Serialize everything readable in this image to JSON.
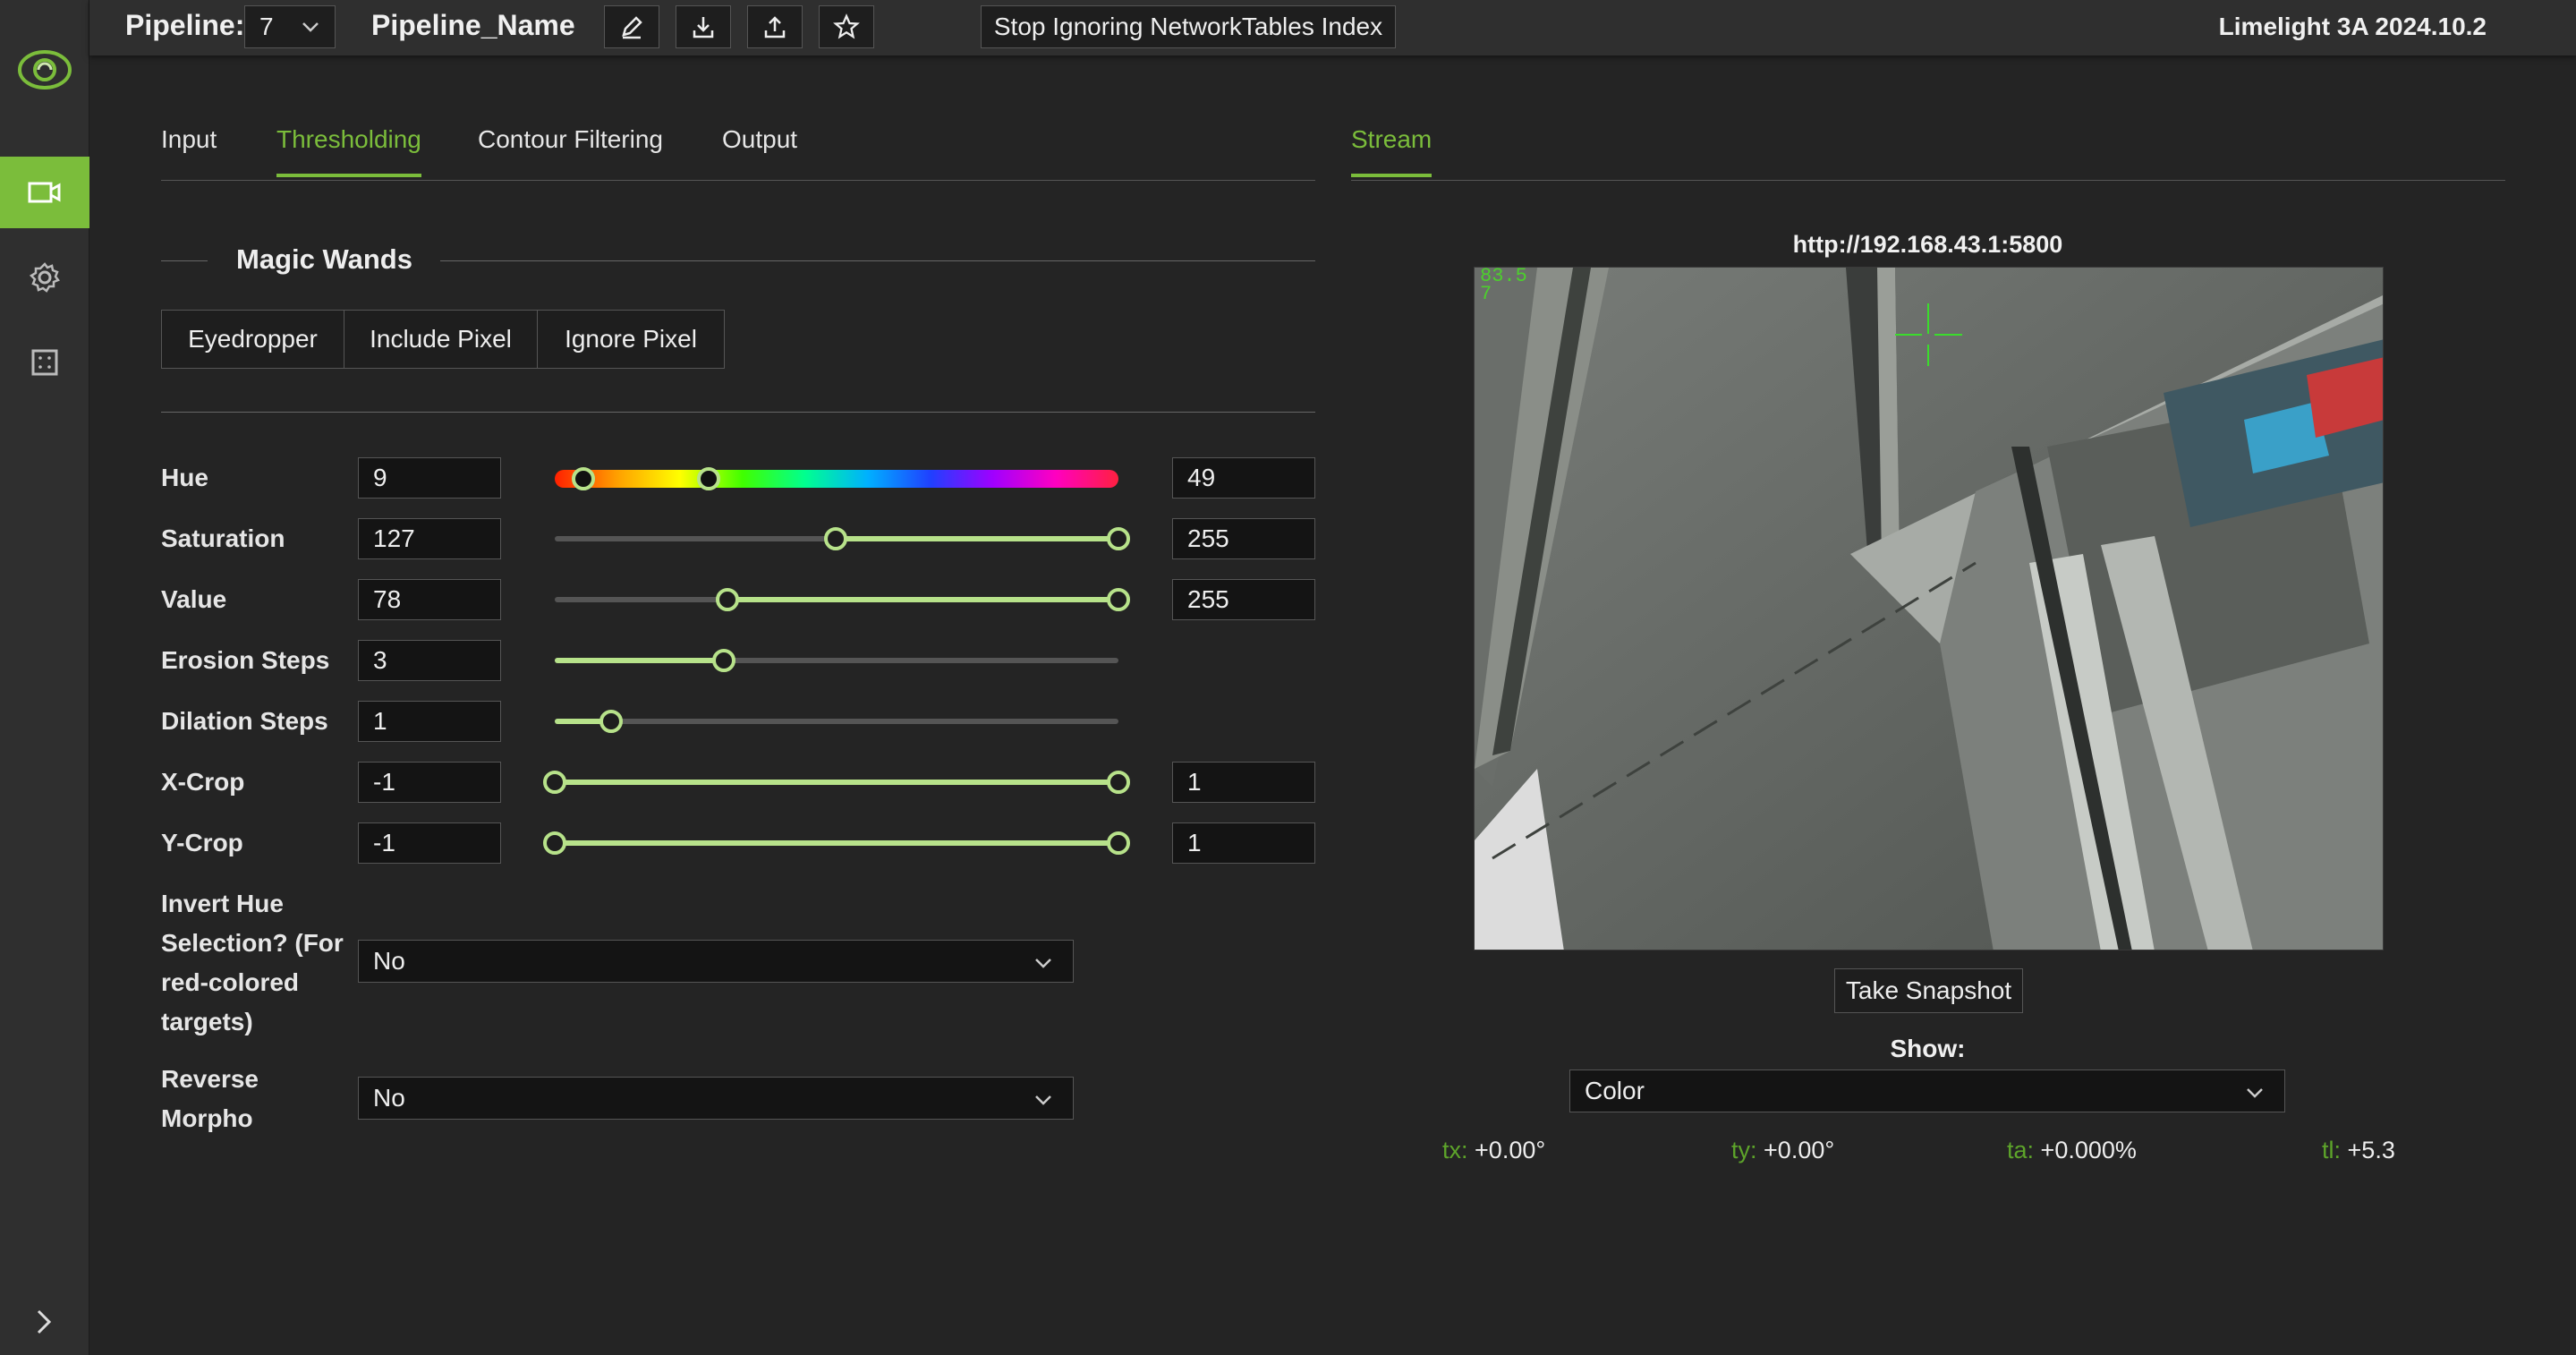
{
  "app": {
    "pipeline_label": "Pipeline:",
    "pipeline_number": "7",
    "pipeline_name": "Pipeline_Name",
    "stop_button": "Stop Ignoring NetworkTables Index",
    "version": "Limelight 3A 2024.10.2",
    "icons": [
      "logo-icon",
      "camera-icon",
      "gear-icon",
      "grid-icon",
      "edit-icon",
      "download-icon",
      "upload-icon",
      "star-icon",
      "chevron-right-icon"
    ]
  },
  "tabs": [
    {
      "label": "Input",
      "active": false
    },
    {
      "label": "Thresholding",
      "active": true
    },
    {
      "label": "Contour Filtering",
      "active": false
    },
    {
      "label": "Output",
      "active": false
    }
  ],
  "stream_tab": {
    "label": "Stream",
    "active": true
  },
  "magic_wands": {
    "title": "Magic Wands",
    "buttons": [
      "Eyedropper",
      "Include Pixel",
      "Ignore Pixel"
    ]
  },
  "thresholds": {
    "hue": {
      "label": "Hue",
      "min": "9",
      "max": "49",
      "range": 180
    },
    "saturation": {
      "label": "Saturation",
      "min": "127",
      "max": "255",
      "range": 255
    },
    "value": {
      "label": "Value",
      "min": "78",
      "max": "255",
      "range": 255
    },
    "erosion": {
      "label": "Erosion Steps",
      "value": "3",
      "fraction": 0.3
    },
    "dilation": {
      "label": "Dilation Steps",
      "value": "1",
      "fraction": 0.1
    },
    "xcrop": {
      "label": "X-Crop",
      "min": "-1",
      "max": "1"
    },
    "ycrop": {
      "label": "Y-Crop",
      "min": "-1",
      "max": "1"
    }
  },
  "options": {
    "invert_hue": {
      "label": "Invert Hue Selection? (For red-colored targets)",
      "value": "No"
    },
    "reverse_morpho": {
      "label": "Reverse Morpho",
      "value": "No"
    }
  },
  "stream": {
    "url": "http://192.168.43.1:5800",
    "overlay_line1": "83.5",
    "overlay_line2": "7",
    "snapshot_button": "Take Snapshot",
    "show_label": "Show:",
    "show_value": "Color",
    "stats": [
      {
        "key": "tx:",
        "value": "+0.00°"
      },
      {
        "key": "ty:",
        "value": "+0.00°"
      },
      {
        "key": "ta:",
        "value": "+0.000%"
      },
      {
        "key": "tl:",
        "value": "+5.3"
      }
    ]
  },
  "colors": {
    "accent": "#7bbd3b",
    "slider": "#b7e28a",
    "background": "#242424",
    "panel": "#2f2f2f"
  }
}
